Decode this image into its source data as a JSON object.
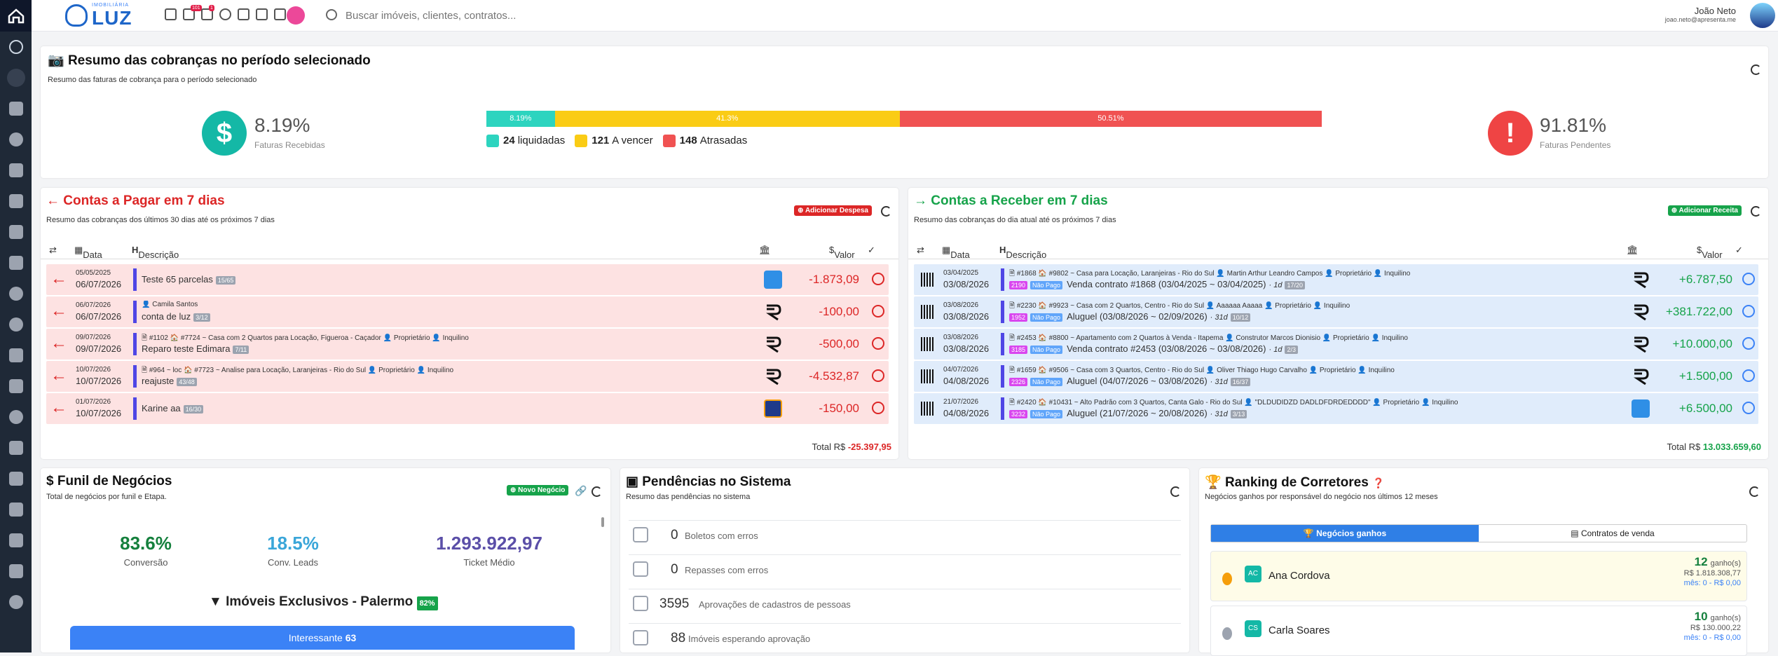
{
  "topbar": {
    "logo_small": "IMOBILIÁRIA",
    "logo_big": "LUZ",
    "badge_notifications": "101",
    "badge_users": "1",
    "search_placeholder": "Buscar imóveis, clientes, contratos...",
    "user_name": "João Neto",
    "user_email": "joao.neto@apresenta.me"
  },
  "summary": {
    "title": "Resumo das cobranças no período selecionado",
    "subtitle": "Resumo das faturas de cobrança para o período selecionado",
    "received_pct": "8.19%",
    "received_label": "Faturas Recebidas",
    "pending_pct": "91.81%",
    "pending_label": "Faturas Pendentes",
    "bar": [
      {
        "label": "8.19%",
        "value": 8.19,
        "color": "#2dd4bf"
      },
      {
        "label": "41.3%",
        "value": 41.3,
        "color": "#facc15"
      },
      {
        "label": "50.51%",
        "value": 50.51,
        "color": "#f05252"
      }
    ],
    "legend": [
      {
        "count": "24",
        "label": "liquidadas",
        "color": "#2dd4bf"
      },
      {
        "count": "121",
        "label": "A vencer",
        "color": "#facc15"
      },
      {
        "count": "148",
        "label": "Atrasadas",
        "color": "#f05252"
      }
    ]
  },
  "pagar": {
    "title_pre": "Contas a ",
    "title_bold": "Pagar",
    "title_post": " em 7 dias",
    "subtitle": "Resumo das cobranças dos últimos 30 dias até os próximos 7 dias",
    "button": "Adicionar Despesa",
    "col_data": "Data",
    "col_desc": "Descrição",
    "col_valor": "Valor",
    "rows": [
      {
        "d1": "05/05/2025",
        "d2": "06/07/2026",
        "desc": "",
        "title": "Teste 65 parcelas",
        "tag": "15/65",
        "value": "-1.873,09",
        "icon": "moneybag"
      },
      {
        "d1": "06/07/2026",
        "d2": "06/07/2026",
        "desc": "👤 Camila Santos",
        "title": "conta de luz",
        "tag": "3/12",
        "value": "-100,00",
        "icon": "R"
      },
      {
        "d1": "09/07/2026",
        "d2": "09/07/2026",
        "desc": "🗎 #1102  🏠 #7724 ~ Casa com 2 Quartos para Locação, Figueroa - Caçador  👤 Proprietário  👤 Inquilino",
        "title": "Reparo teste Edimara",
        "tag": "7/11",
        "value": "-500,00",
        "icon": "R"
      },
      {
        "d1": "10/07/2026",
        "d2": "10/07/2026",
        "desc": "🗎 #964 ~ loc  🏠 #7723 ~ Analise para Locação, Laranjeiras - Rio do Sul  👤 Proprietário  👤 Inquilino",
        "title": "reajuste",
        "tag": "43/48",
        "value": "-4.532,87",
        "icon": "R"
      },
      {
        "d1": "01/07/2026",
        "d2": "10/07/2026",
        "desc": "",
        "title": "Karine aa",
        "tag": "16/30",
        "value": "-150,00",
        "icon": "itau"
      }
    ],
    "total_label": "Total R$",
    "total_value": "-25.397,95"
  },
  "receber": {
    "title_pre": "Contas a ",
    "title_bold": "Receber",
    "title_post": " em 7 dias",
    "subtitle": "Resumo das cobranças do dia atual até os próximos 7 dias",
    "button": "Adicionar Receita",
    "col_data": "Data",
    "col_desc": "Descrição",
    "col_valor": "Valor",
    "rows": [
      {
        "d1": "03/04/2025",
        "d2": "03/08/2026",
        "desc": "🗎 #1868  🏠 #9802 ~ Casa para Locação, Laranjeiras - Rio do Sul  👤 Martin Arthur Leandro Campos  👤 Proprietário  👤 Inquilino",
        "code": "2190",
        "status": "Não Pago",
        "title": "Venda contrato #1868 (03/04/2025 ~ 03/04/2025)",
        "days": "· 1d",
        "tag": "17/20",
        "value": "+6.787,50",
        "icon": "R"
      },
      {
        "d1": "03/08/2026",
        "d2": "03/08/2026",
        "desc": "🗎 #2230  🏠 #9923 ~ Casa com 2 Quartos, Centro - Rio do Sul  👤 Aaaaaa Aaaaa  👤 Proprietário  👤 Inquilino",
        "code": "1952",
        "status": "Não Pago",
        "title": "Aluguel (03/08/2026 ~ 02/09/2026)",
        "days": "· 31d",
        "tag": "10/12",
        "value": "+381.722,00",
        "icon": "R"
      },
      {
        "d1": "03/08/2026",
        "d2": "03/08/2026",
        "desc": "🗎 #2453  🏠 #8800 ~ Apartamento com 2 Quartos à Venda - Itapema  👤 Construtor Marcos Dionisio  👤 Proprietário  👤 Inquilino",
        "code": "3185",
        "status": "Não Pago",
        "title": "Venda contrato #2453 (03/08/2026 ~ 03/08/2026)",
        "days": "· 1d",
        "tag": "2/3",
        "value": "+10.000,00",
        "icon": "R"
      },
      {
        "d1": "04/07/2026",
        "d2": "04/08/2026",
        "desc": "🗎 #1659  🏠 #9506 ~ Casa com 3 Quartos, Centro - Rio do Sul  👤 Oliver Thiago Hugo Carvalho  👤 Proprietário  👤 Inquilino",
        "code": "2326",
        "status": "Não Pago",
        "title": "Aluguel (04/07/2026 ~ 03/08/2026)",
        "days": "· 31d",
        "tag": "16/37",
        "value": "+1.500,00",
        "icon": "R"
      },
      {
        "d1": "21/07/2026",
        "d2": "04/08/2026",
        "desc": "🗎 #2420  🏠 #10431 ~ Alto Padrão com 3 Quartos, Canta Galo - Rio do Sul  👤 \"DLDUDIDZD DADLDFDRDEDDDD\"  👤 Proprietário  👤 Inquilino",
        "code": "3232",
        "status": "Não Pago",
        "title": "Aluguel (21/07/2026 ~ 20/08/2026)",
        "days": "· 31d",
        "tag": "3/13",
        "value": "+6.500,00",
        "icon": "moneybag"
      }
    ],
    "total_label": "Total R$",
    "total_value": "13.033.659,60"
  },
  "funil": {
    "title": "Funil de Negócios",
    "subtitle": "Total de negócios por funil e Etapa.",
    "button": "Novo Negócio",
    "conv_value": "83.6%",
    "conv_label": "Conversão",
    "leads_value": "18.5%",
    "leads_label": "Conv. Leads",
    "ticket_value": "1.293.922,97",
    "ticket_label": "Ticket Médio",
    "funnel_name": "Imóveis Exclusivos - Palermo",
    "funnel_badge": "82%",
    "stage_label": "Interessante",
    "stage_count": "63"
  },
  "pendencias": {
    "title": "Pendências no Sistema",
    "subtitle": "Resumo das pendências no sistema",
    "items": [
      {
        "n": "0",
        "label": "Boletos com erros"
      },
      {
        "n": "0",
        "label": "Repasses com erros"
      },
      {
        "n": "3595",
        "label": "Aprovações de cadastros de pessoas"
      },
      {
        "n": "88",
        "label": "Imóveis esperando aprovação"
      }
    ]
  },
  "ranking": {
    "title": "Ranking de Corretores",
    "subtitle": "Negócios ganhos por responsável do negócio nos últimos 12 meses",
    "tab_active": "Negócios ganhos",
    "tab_other": "Contratos de venda",
    "people": [
      {
        "initials": "AC",
        "name": "Ana Cordova",
        "count": "12",
        "unit": "ganho(s)",
        "amount": "R$ 1.818.308,77",
        "month": "mês: 0 - R$ 0,00",
        "medal": "#f59e0b",
        "bg": "#fefce8"
      },
      {
        "initials": "CS",
        "name": "Carla Soares",
        "count": "10",
        "unit": "ganho(s)",
        "amount": "R$ 130.000,22",
        "month": "mês: 0 - R$ 0,00",
        "medal": "#9ca3af",
        "bg": "#ffffff"
      }
    ]
  }
}
